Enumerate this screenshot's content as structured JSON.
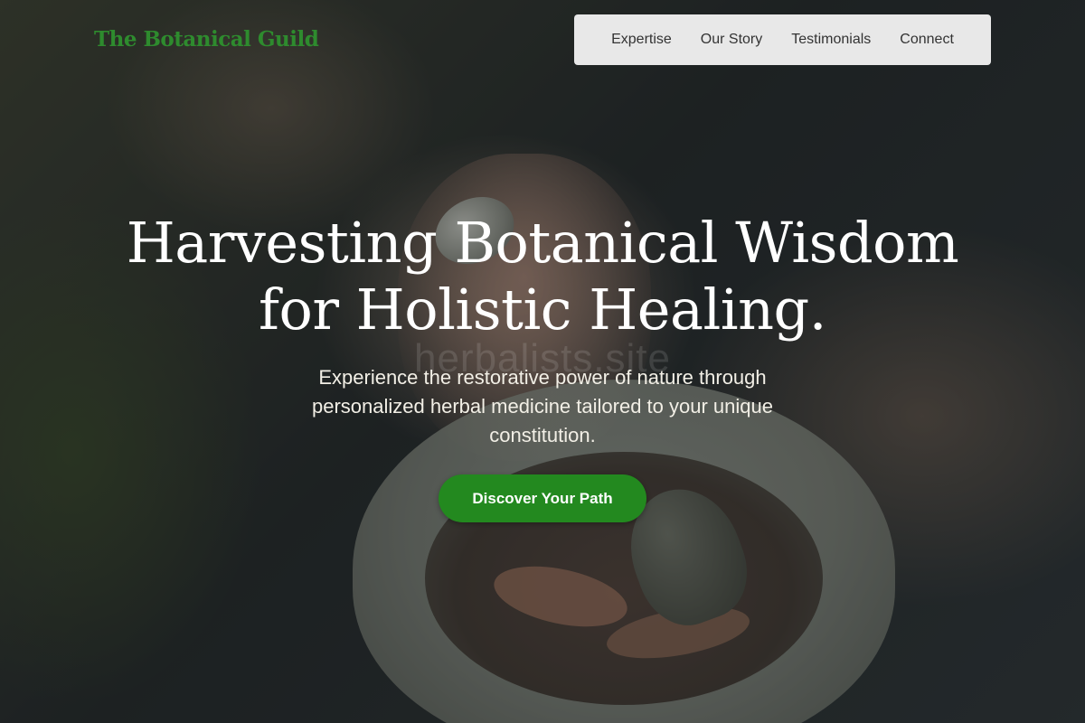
{
  "header": {
    "logo_text": "The Botanical Guild",
    "nav": [
      {
        "label": "Expertise"
      },
      {
        "label": "Our Story"
      },
      {
        "label": "Testimonials"
      },
      {
        "label": "Connect"
      }
    ]
  },
  "hero": {
    "headline_line1": "Harvesting Botanical Wisdom",
    "headline_line2": "for Holistic Healing.",
    "subtitle": "Experience the restorative power of nature through personalized herbal medicine tailored to your unique constitution.",
    "watermark": "herbalists.site",
    "cta_label": "Discover Your Path"
  },
  "colors": {
    "brand_green": "#2e8b2e",
    "button_green": "#23891f",
    "nav_background": "#f0f0f0",
    "headline_text": "#ffffff"
  }
}
